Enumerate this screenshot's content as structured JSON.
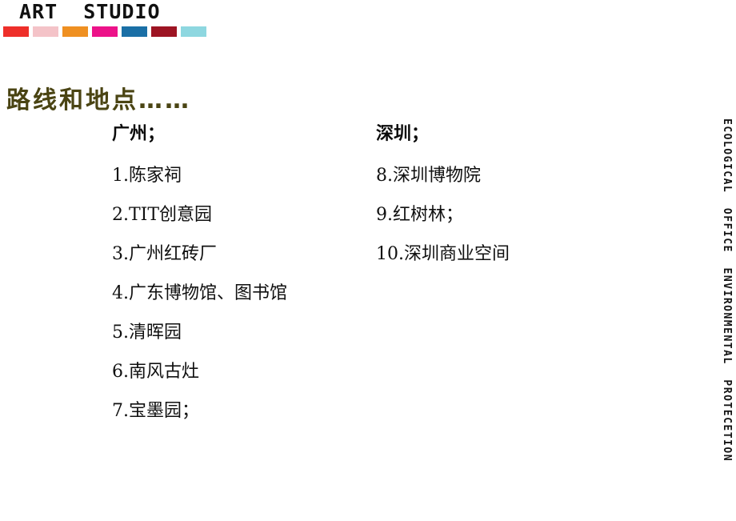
{
  "brand": {
    "title": "ART  STUDIO",
    "swatches": [
      {
        "name": "swatch-red",
        "color": "#ee2f2a"
      },
      {
        "name": "swatch-pink",
        "color": "#f4c3c8"
      },
      {
        "name": "swatch-orange",
        "color": "#ef9021"
      },
      {
        "name": "swatch-magenta",
        "color": "#ec1289"
      },
      {
        "name": "swatch-blue",
        "color": "#1a6fa6"
      },
      {
        "name": "swatch-maroon",
        "color": "#9d1423"
      },
      {
        "name": "swatch-light-cyan",
        "color": "#8ed7e0"
      }
    ]
  },
  "section": {
    "title": "路线和地点……",
    "title_color": "#4a4413"
  },
  "columns": [
    {
      "key": "guangzhou",
      "header": "广州；",
      "items": [
        "1.陈家祠",
        "2.TIT创意园",
        "3.广州红砖厂",
        "4.广东博物馆、图书馆",
        "5.清晖园",
        "6.南风古灶",
        "7.宝墨园；"
      ]
    },
    {
      "key": "shenzhen",
      "header": "深圳；",
      "items": [
        "8.深圳博物院",
        "9.红树林；",
        "10.深圳商业空间"
      ]
    }
  ],
  "side": {
    "text": "ECOLOGICAL  OFFICE  ENVIRONMENTAL  PROTECETION"
  }
}
